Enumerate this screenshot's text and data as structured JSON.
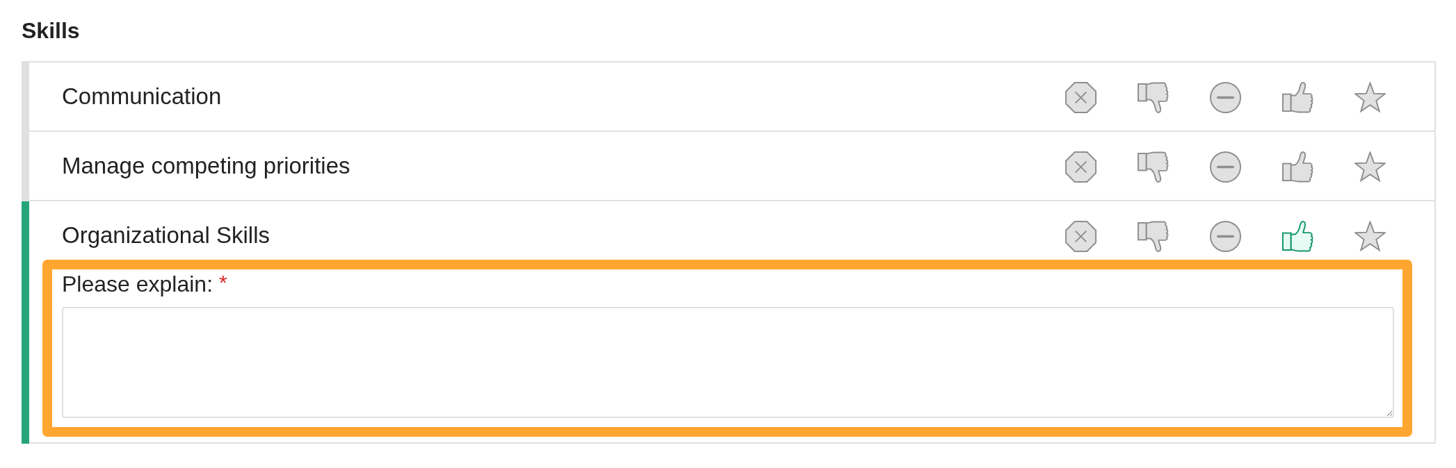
{
  "section": {
    "title": "Skills"
  },
  "skills": [
    {
      "name": "Communication",
      "ratings": [
        {
          "kind": "octagon_x",
          "selected": false
        },
        {
          "kind": "thumbs_down",
          "selected": false
        },
        {
          "kind": "minus_circle",
          "selected": false
        },
        {
          "kind": "thumbs_up",
          "selected": false
        },
        {
          "kind": "star",
          "selected": false
        }
      ]
    },
    {
      "name": "Manage competing priorities",
      "ratings": [
        {
          "kind": "octagon_x",
          "selected": false
        },
        {
          "kind": "thumbs_down",
          "selected": false
        },
        {
          "kind": "minus_circle",
          "selected": false
        },
        {
          "kind": "thumbs_up",
          "selected": false
        },
        {
          "kind": "star",
          "selected": false
        }
      ]
    },
    {
      "name": "Organizational Skills",
      "ratings": [
        {
          "kind": "octagon_x",
          "selected": false
        },
        {
          "kind": "thumbs_down",
          "selected": false
        },
        {
          "kind": "minus_circle",
          "selected": false
        },
        {
          "kind": "thumbs_up",
          "selected": true
        },
        {
          "kind": "star",
          "selected": false
        }
      ],
      "explanation": {
        "label": "Please explain:",
        "required_mark": "*",
        "highlighted": true
      }
    }
  ]
}
